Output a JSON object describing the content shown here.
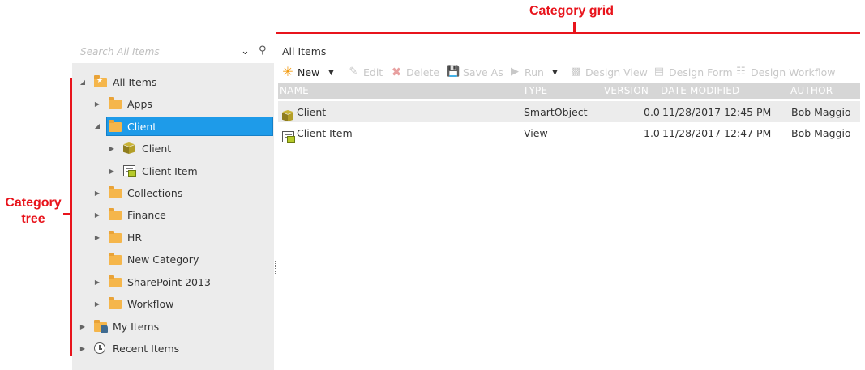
{
  "annotations": {
    "grid_label": "Category grid",
    "tree_label_line1": "Category",
    "tree_label_line2": "tree"
  },
  "search": {
    "placeholder": "Search All Items"
  },
  "tree": {
    "items": [
      {
        "label": "All Items",
        "icon": "star-folder-icon",
        "expanded": true
      },
      {
        "label": "Apps",
        "icon": "folder-icon",
        "expanded": false
      },
      {
        "label": "Client",
        "icon": "folder-icon",
        "expanded": true,
        "selected": true
      },
      {
        "label": "Client",
        "icon": "smartobject-icon",
        "expanded": false
      },
      {
        "label": "Client Item",
        "icon": "view-icon",
        "expanded": false
      },
      {
        "label": "Collections",
        "icon": "folder-icon",
        "expanded": false
      },
      {
        "label": "Finance",
        "icon": "folder-icon",
        "expanded": false
      },
      {
        "label": "HR",
        "icon": "folder-icon",
        "expanded": false
      },
      {
        "label": "New Category",
        "icon": "folder-icon"
      },
      {
        "label": "SharePoint 2013",
        "icon": "folder-icon",
        "expanded": false
      },
      {
        "label": "Workflow",
        "icon": "folder-icon",
        "expanded": false
      },
      {
        "label": "My Items",
        "icon": "user-folder-icon",
        "expanded": false
      },
      {
        "label": "Recent Items",
        "icon": "clock-icon",
        "expanded": false
      }
    ]
  },
  "grid": {
    "title": "All Items",
    "toolbar": {
      "new": "New",
      "edit": "Edit",
      "delete": "Delete",
      "save_as": "Save As",
      "run": "Run",
      "design_view": "Design View",
      "design_form": "Design Form",
      "design_workflow": "Design Workflow"
    },
    "columns": {
      "name": "NAME",
      "type": "TYPE",
      "version": "VERSION",
      "date_modified": "DATE MODIFIED",
      "author": "AUTHOR"
    },
    "rows": [
      {
        "name": "Client",
        "type": "SmartObject",
        "version": "0.0",
        "date_modified": "11/28/2017 12:45 PM",
        "author": "Bob Maggio",
        "icon": "smartobject-icon"
      },
      {
        "name": "Client Item",
        "type": "View",
        "version": "1.0",
        "date_modified": "11/28/2017 12:47 PM",
        "author": "Bob Maggio",
        "icon": "view-icon"
      }
    ]
  },
  "colors": {
    "selection": "#1e9be9",
    "annotation": "#e8141c",
    "folder": "#f5b64b",
    "new_icon": "#f39c12",
    "delete_icon": "#e85a5a"
  }
}
